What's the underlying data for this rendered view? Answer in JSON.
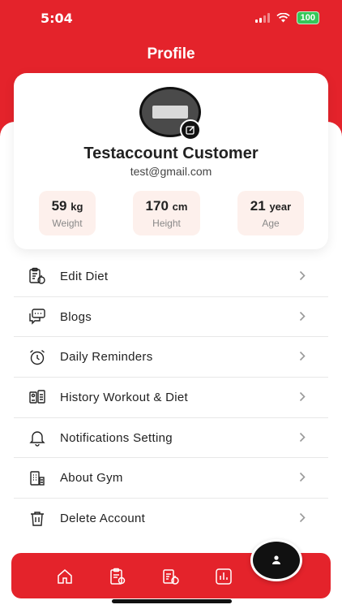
{
  "status_bar": {
    "time": "5:04",
    "battery": "100"
  },
  "header": {
    "title": "Profile"
  },
  "profile": {
    "name": "Testaccount Customer",
    "email": "test@gmail.com",
    "stats": [
      {
        "value": "59",
        "unit": "kg",
        "label": "Weight"
      },
      {
        "value": "170",
        "unit": "cm",
        "label": "Height"
      },
      {
        "value": "21",
        "unit": "year",
        "label": "Age"
      }
    ]
  },
  "menu": [
    {
      "label": "Edit Diet",
      "icon": "diet-clipboard-icon"
    },
    {
      "label": "Blogs",
      "icon": "chat-bubbles-icon"
    },
    {
      "label": "Daily Reminders",
      "icon": "alarm-clock-icon"
    },
    {
      "label": "History Workout & Diet",
      "icon": "history-book-icon"
    },
    {
      "label": "Notifications Setting",
      "icon": "bell-icon"
    },
    {
      "label": "About Gym",
      "icon": "gym-building-icon"
    },
    {
      "label": "Delete Account",
      "icon": "trash-icon"
    }
  ],
  "bottom_nav": [
    "home-icon",
    "workout-clipboard-icon",
    "diet-clipboard-icon",
    "stats-chart-icon"
  ],
  "colors": {
    "brand_red": "#e4232b",
    "stat_bg": "#fdf0ec"
  }
}
